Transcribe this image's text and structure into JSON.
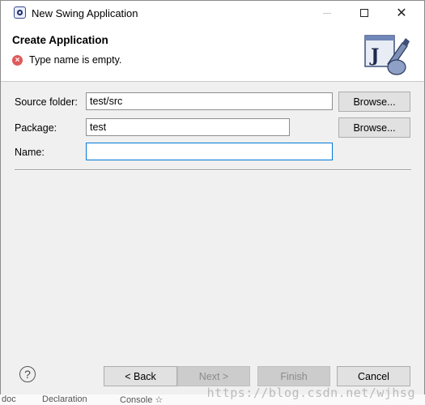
{
  "window": {
    "title": "New Swing Application",
    "minimize_icon": "minimize-icon",
    "maximize_icon": "maximize-icon",
    "close_glyph": "✕"
  },
  "header": {
    "title": "Create Application",
    "error_message": "Type name is empty.",
    "error_icon_glyph": "×",
    "banner_letter": "J"
  },
  "form": {
    "source_folder": {
      "label": "Source folder:",
      "value": "test/src",
      "browse_label": "Browse..."
    },
    "package": {
      "label": "Package:",
      "value": "test",
      "browse_label": "Browse..."
    },
    "name": {
      "label": "Name:",
      "value": ""
    }
  },
  "footer": {
    "help_glyph": "?",
    "back_label": "< Back",
    "next_label": "Next >",
    "finish_label": "Finish",
    "cancel_label": "Cancel"
  },
  "background_strip": {
    "items": [
      "doc",
      "Declaration",
      "Console ☆"
    ]
  },
  "watermark": "https://blog.csdn.net/wjhsg",
  "colors": {
    "accent_focus": "#0078d7",
    "error_red": "#e05a5a",
    "dialog_bg": "#f0f0f0"
  }
}
